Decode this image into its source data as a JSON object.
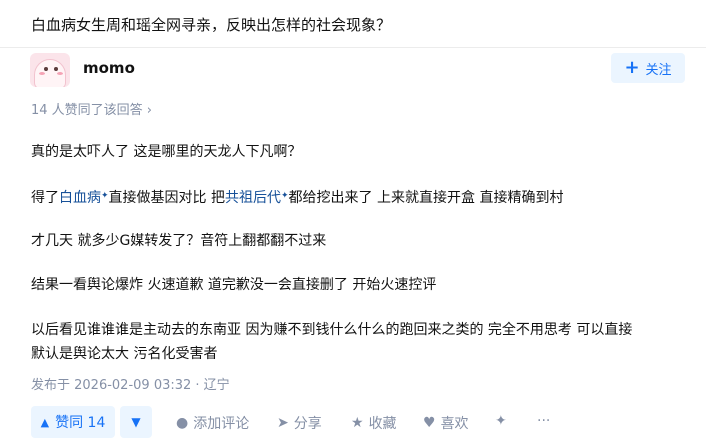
{
  "question": {
    "title": "白血病女生周和瑶全网寻亲，反映出怎样的社会现象？"
  },
  "author": {
    "name": "momo",
    "follow_label": "关注"
  },
  "voters_text": "14 人赞同了该回答 ›",
  "answer": {
    "p1": "真的是太吓人了 这是哪里的天龙人下凡啊？",
    "p2_pre": "得了",
    "p2_link1": "白血病",
    "p2_mid1": "直接做基因对比 把",
    "p2_link2": "共祖后代",
    "p2_post": "都给挖出来了 上来就直接开盒 直接精确到村",
    "p3": "才几天 就多少G媒转发了？音符上翻都翻不过来",
    "p4": "结果一看舆论爆炸 火速道歉 道完歉没一会直接删了 开始火速控评",
    "p5_line1": "以后看见谁谁谁是主动去的东南亚 因为赚不到钱什么什么的跑回来之类的 完全不用思考 可以直接",
    "p5_line2": "默认是舆论太大 污名化受害者"
  },
  "published": "发布于 2026-02-09 03:32 · 辽宁",
  "actions": {
    "upvote_label": "赞同 14",
    "comment_label": "添加评论",
    "share_label": "分享",
    "collect_label": "收藏",
    "like_label": "喜欢",
    "more_label": "···"
  },
  "colors": {
    "accent": "#1772f6",
    "link": "#175199",
    "muted": "#8590a6",
    "accent_bg": "#ebf5ff"
  }
}
